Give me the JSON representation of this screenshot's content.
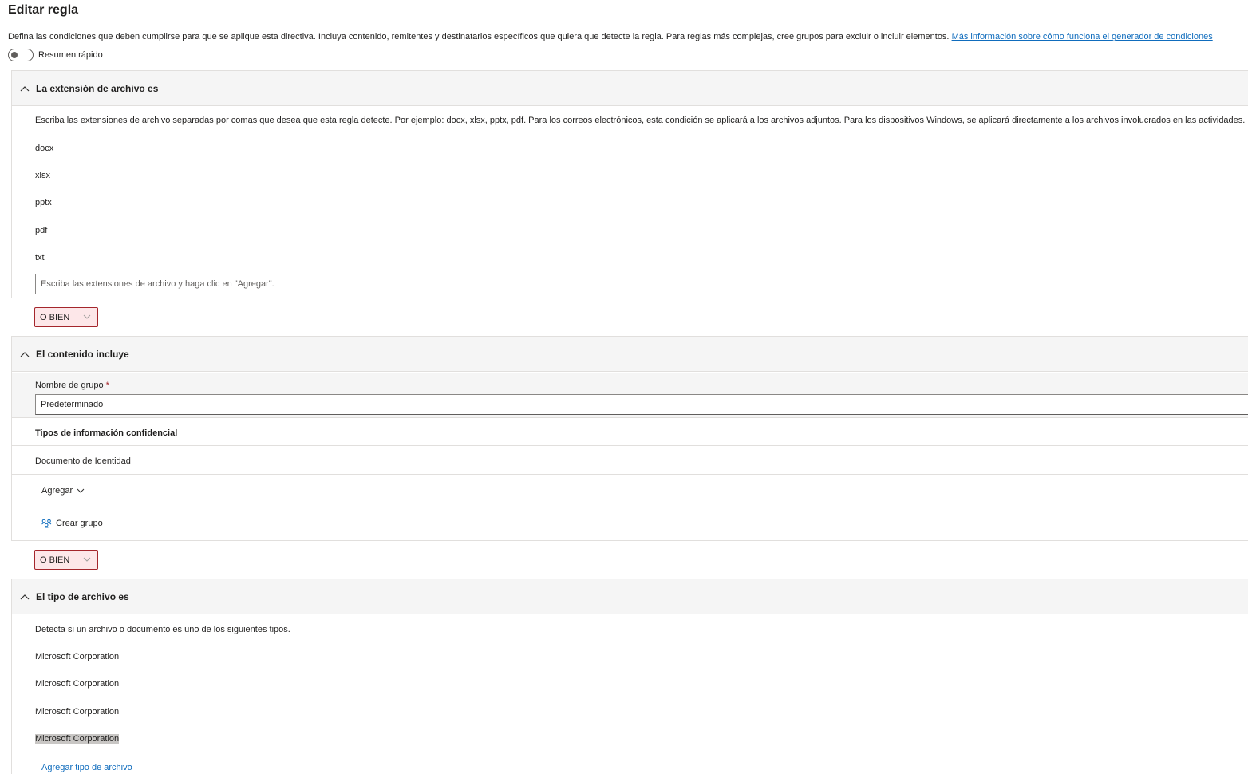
{
  "page": {
    "title": "Editar regla",
    "description": "Defina las condiciones que deben cumplirse para que se aplique esta directiva. Incluya contenido, remitentes y destinatarios específicos que quiera que detecte la regla. Para reglas más complejas, cree grupos para excluir o incluir elementos.",
    "learn_more_link": "Más información sobre cómo funciona el generador de condiciones",
    "toggle_label": "Resumen rápido"
  },
  "section_extension": {
    "title": "La extensión de archivo es",
    "instructions": "Escriba las extensiones de archivo separadas por comas que desea que esta regla detecte. Por ejemplo: docx, xlsx, pptx, pdf. Para los correos electrónicos, esta condición se aplicará a los archivos adjuntos. Para los dispositivos Windows, se aplicará directamente a los archivos involucrados en las actividades.",
    "extensions": [
      "docx",
      "xlsx",
      "pptx",
      "pdf",
      "txt"
    ],
    "input_placeholder": "Escriba las extensiones de archivo y haga clic en \"Agregar\"."
  },
  "operator_1": {
    "label": "O BIEN"
  },
  "section_content": {
    "title": "El contenido incluye",
    "group_name_label": "Nombre de grupo",
    "required_mark": "*",
    "group_name_value": "Predeterminado",
    "sit_header": "Tipos de información confidencial",
    "sit_items": [
      "Documento de Identidad"
    ],
    "add_label": "Agregar",
    "create_group_label": "Crear grupo"
  },
  "operator_2": {
    "label": "O BIEN"
  },
  "section_filetype": {
    "title": "El tipo de archivo es",
    "description": "Detecta si un archivo o documento es uno de los siguientes tipos.",
    "items": [
      "Microsoft Corporation",
      "Microsoft Corporation",
      "Microsoft Corporation",
      "Microsoft Corporation"
    ],
    "add_link": "Agregar tipo de archivo"
  },
  "colors": {
    "accent": "#0f6cbd",
    "or_background": "#fde7e9",
    "or_border": "#a4262c",
    "header_background": "#f5f5f5"
  }
}
